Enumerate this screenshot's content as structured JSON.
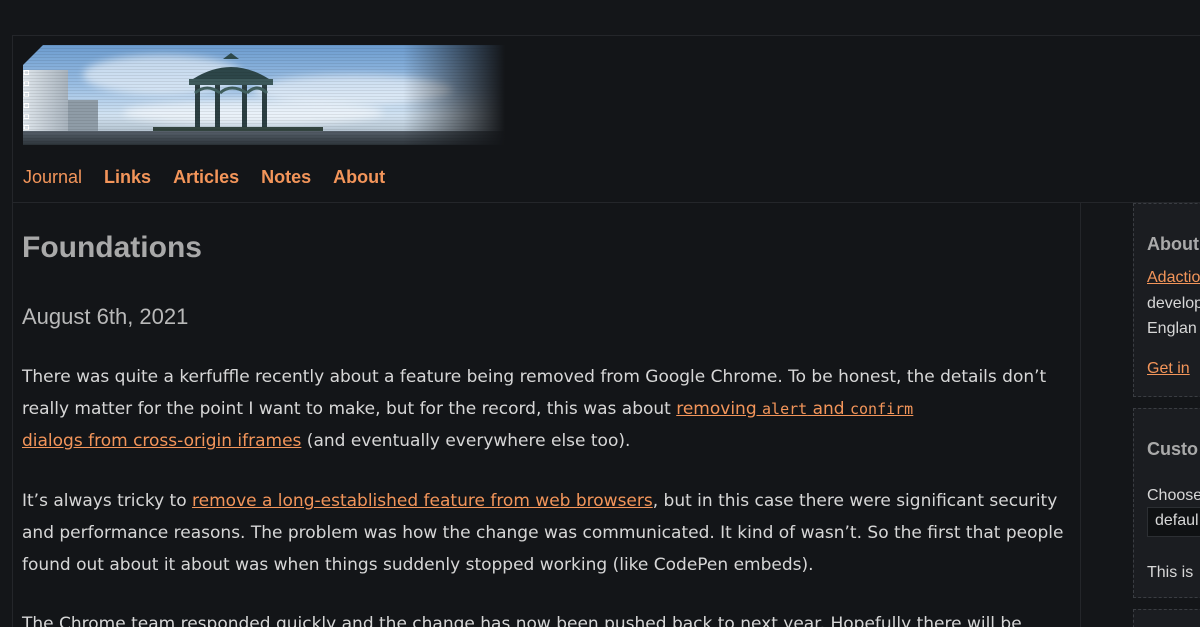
{
  "nav": {
    "items": [
      {
        "label": "Journal"
      },
      {
        "label": "Links"
      },
      {
        "label": "Articles"
      },
      {
        "label": "Notes"
      },
      {
        "label": "About"
      }
    ]
  },
  "article": {
    "title": "Foundations",
    "date": "August 6th, 2021",
    "p1": {
      "text_a": "There was quite a kerfuffle recently about a feature being removed from Google Chrome. To be honest, the details don’t really matter for the point I want to make, but for the record, this was about ",
      "link_a": "removing ",
      "code_alert": "alert",
      "link_and": " and ",
      "code_confirm": "confirm",
      "link_b": "dialogs from cross-origin iframes",
      "text_b": " (and eventually everywhere else too)."
    },
    "p2": {
      "text_a": "It’s always tricky to ",
      "link": "remove a long-established feature from web browsers",
      "text_b": ", but in this case there were significant security and performance reasons. The problem was how the change was communicated. It kind of wasn’t. So the first that people found out about it about was when things suddenly stopped working (like CodePen embeds)."
    },
    "p3": {
      "text": "The Chrome team responded quickly and the change has now been pushed back to next year. Hopefully there will be"
    }
  },
  "sidebar": {
    "about": {
      "heading": "About",
      "link": "Adaction",
      "line1": "develop",
      "line2": "Englan",
      "contact": "Get in"
    },
    "customise": {
      "heading": "Custo",
      "label": "Choose",
      "select_value": "defaul",
      "note": "This is"
    }
  }
}
